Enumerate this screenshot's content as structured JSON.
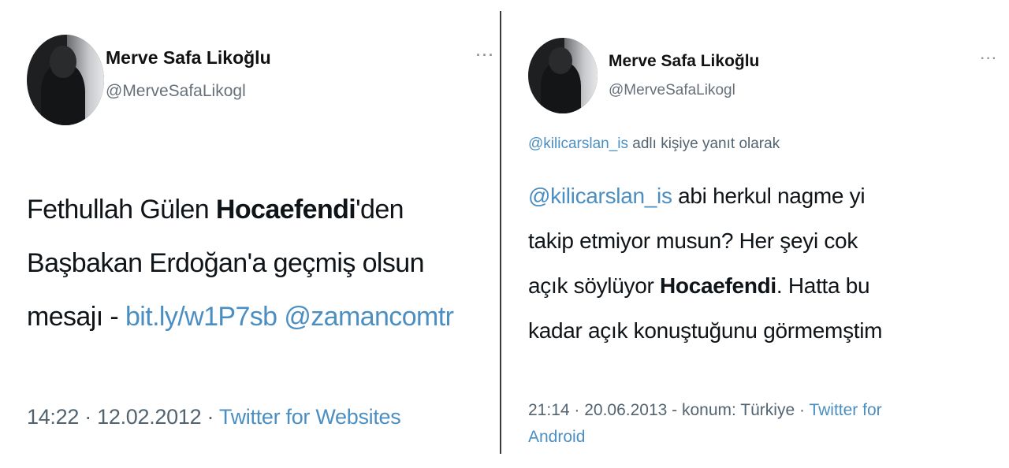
{
  "tweets": [
    {
      "display_name": "Merve Safa Likoğlu",
      "handle": "@MerveSafaLikogl",
      "more": "···",
      "lines": [
        {
          "a": "Fethullah Gülen ",
          "b": "Hocaefendi",
          "c": "'den"
        },
        {
          "a": "Başbakan Erdoğan'a geçmiş olsun"
        },
        {
          "a": "mesajı - ",
          "link1": "bit.ly/w1P7sb",
          "link2": "@zamancomtr"
        }
      ],
      "time": "14:22 · 12.02.2012 · ",
      "source": "Twitter for Websites"
    },
    {
      "display_name": "Merve Safa Likoğlu",
      "handle": "@MerveSafaLikogl",
      "more": "···",
      "reply_to_user": "@kilicarslan_is",
      "reply_to_text": " adlı kişiye yanıt olarak",
      "lines": [
        {
          "link": "@kilicarslan_is",
          "a": " abi herkul nagme  yi"
        },
        {
          "a": "takip etmiyor musun?  Her şeyi cok"
        },
        {
          "a": "açık söylüyor ",
          "b": "Hocaefendi",
          "c": ". Hatta bu"
        },
        {
          "a": "kadar açık konuştuğunu görmemştim"
        }
      ],
      "time": "21:14 · 20.06.2013 - konum: Türkiye · ",
      "source_line1": "Twitter for",
      "source_line2": "Android"
    }
  ]
}
